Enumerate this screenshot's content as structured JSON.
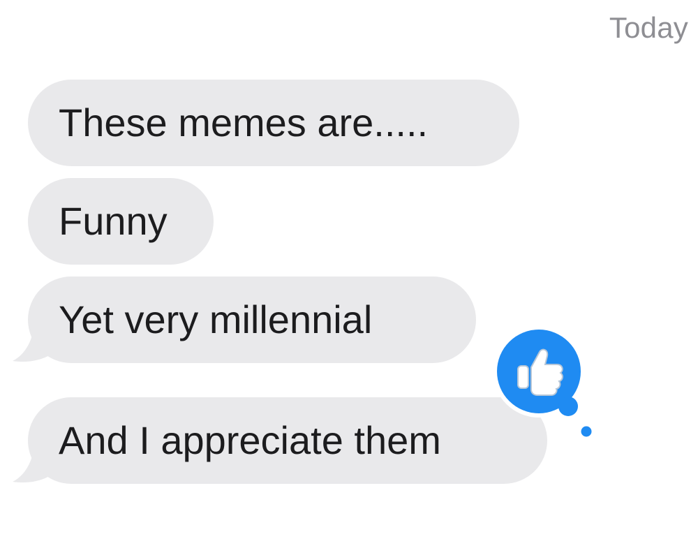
{
  "conversation": {
    "timestamp": "Today",
    "messages": [
      {
        "text": "These memes are....."
      },
      {
        "text": "Funny"
      },
      {
        "text": "Yet very millennial"
      },
      {
        "text": "And I appreciate them"
      }
    ],
    "reaction": {
      "icon": "thumbs-up-icon",
      "background_color": "#1f8bf2"
    }
  },
  "colors": {
    "incoming_bubble": "#e9e9eb",
    "timestamp": "#8e8e93",
    "text": "#1c1c1e"
  }
}
